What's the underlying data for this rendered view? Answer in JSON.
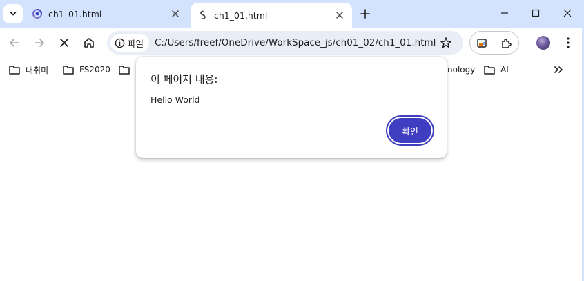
{
  "tabs": [
    {
      "title": "ch1_01.html",
      "state": "inactive"
    },
    {
      "title": "ch1_01.html",
      "state": "active"
    }
  ],
  "omnibox": {
    "chip_label": "파일",
    "url": "C:/Users/freef/OneDrive/WorkSpace_js/ch01_02/ch1_01.html"
  },
  "bookmarks": [
    {
      "label": "내취미"
    },
    {
      "label": "FS2020"
    },
    {
      "label": ""
    },
    {
      "label": "nology"
    },
    {
      "label": "AI"
    }
  ],
  "dialog": {
    "title": "이 페이지 내용:",
    "message": "Hello World",
    "ok_label": "확인"
  },
  "colors": {
    "tabstrip_bg": "#d3e3fd",
    "omnibox_bg": "#e9eef6",
    "accent_button": "#3f3ec0"
  },
  "icons": {
    "tab_search": "chevron-down-icon",
    "new_tab": "plus-icon",
    "back": "arrow-left-icon",
    "forward": "arrow-right-icon",
    "stop": "close-icon",
    "home": "home-icon",
    "info": "info-icon",
    "star": "star-icon",
    "extensions": "puzzle-icon",
    "menu": "more-vertical-icon",
    "bookmark_folder": "folder-icon",
    "overflow": "double-chevron-right-icon"
  }
}
